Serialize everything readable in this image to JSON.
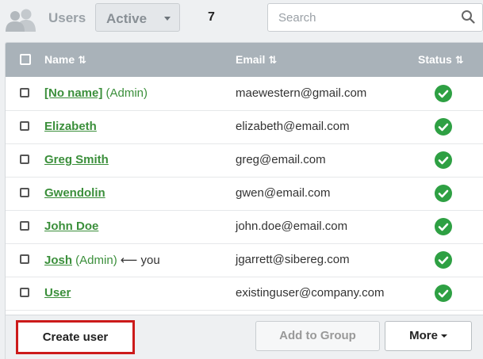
{
  "header": {
    "section_label": "Users",
    "filter_value": "Active",
    "user_count": "7",
    "search_placeholder": "Search"
  },
  "table": {
    "columns": {
      "name": "Name",
      "email": "Email",
      "status": "Status"
    },
    "sort_glyph": "⇅",
    "rows": [
      {
        "name": "[No name]",
        "role": " (Admin)",
        "suffix": "",
        "email": "maewestern@gmail.com",
        "status": "active"
      },
      {
        "name": "Elizabeth",
        "role": "",
        "suffix": "",
        "email": "elizabeth@email.com",
        "status": "active"
      },
      {
        "name": "Greg Smith",
        "role": "",
        "suffix": "",
        "email": "greg@email.com",
        "status": "active"
      },
      {
        "name": "Gwendolin",
        "role": "",
        "suffix": "",
        "email": "gwen@email.com",
        "status": "active"
      },
      {
        "name": "John Doe",
        "role": "",
        "suffix": "",
        "email": "john.doe@email.com",
        "status": "active"
      },
      {
        "name": "Josh",
        "role": " (Admin)",
        "suffix": " ⟵ you",
        "email": "jgarrett@sibereg.com",
        "status": "active"
      },
      {
        "name": "User",
        "role": "",
        "suffix": "",
        "email": "existinguser@company.com",
        "status": "active"
      }
    ]
  },
  "footer": {
    "create_label": "Create user",
    "add_group_label": "Add to Group",
    "more_label": "More"
  },
  "colors": {
    "status_ok": "#2ea043",
    "highlight": "#cc1a1a",
    "header_bg": "#a9b2b9"
  }
}
